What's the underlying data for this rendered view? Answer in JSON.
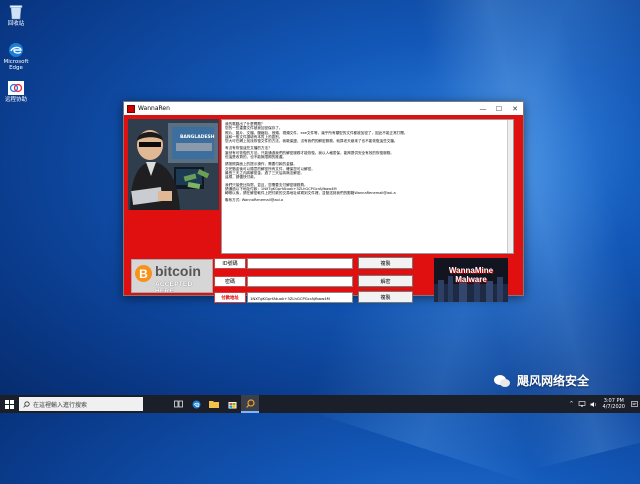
{
  "desktop": {
    "icons": [
      {
        "label": "回收站",
        "icon": "recycle-bin-icon"
      },
      {
        "label": "Microsoft Edge",
        "icon": "edge-icon"
      },
      {
        "label": "远程协助",
        "icon": "remote-assist-icon"
      }
    ]
  },
  "window": {
    "title": "WannaRen",
    "controls": {
      "minimize": "—",
      "maximize": "☐",
      "close": "✕"
    },
    "ransom_lines": [
      "我的電腦出了什麼問題？",
      "您的一些重要文件被我加密保存了。",
      "照片、圖片、文檔、壓縮包、音頻、視頻文件、exe文件等，幾乎所有類型的文件都被加密了，因此不能正常打開。",
      "這和一般文件損壞有本質上的區別。",
      "您大可在網上找找恢復文件的方法，我敢保證，沒有我們的解密服務，就算老天爺來了也不能恢復這些文檔。",
      "",
      "有沒有恢復這些文檔的方法？",
      "當然有可恢復的方法。只能通過我們的解密服務才能恢復。我以人格擔保，能夠提供安全有效的恢復服務。",
      "但這是收費的，也不能無限期的推遲。",
      "",
      "請按照頁面上的提示操作，需要付款的金額。",
      "交完贖金後可以隨意的解密所有文件，確保您可以解密。",
      "最長三天之內將解密金，過了三天后將無法解密。",
      "這樣，請儘快付款。",
      "",
      "我們只接受比特幣，並且，您需要支付解密服務費。",
      "請通過以下地址付款：1NXTgKGprfAtuok+3ZLhGCPGcrAjfbaw4M",
      "轉帳以後，請在解密軟件上把付款的交易地址填寫到文件裡，並發送到我們的郵箱WannaRenemail@aol.a",
      "",
      "聯系方式: WannaRenemail@aol.a"
    ],
    "form": {
      "row1_label": "ID號碼",
      "row1_value": "",
      "row2_label": "密碼",
      "row2_value": "",
      "row3_label": "付款地址",
      "row3_value": "1NXTgKGprfAtuok+3ZLhGCPGcrAjfbaw4M",
      "btn1": "複製",
      "btn2": "解密",
      "btn3": "複製"
    },
    "bitcoin_badge": {
      "symbol": "B",
      "word": "bitcoin",
      "accepted": "ACCEPTED HERE"
    },
    "malware_banner": "WannaMine Malware",
    "photo_caption": "BANGLADESH"
  },
  "taskbar": {
    "search_placeholder": "在這裡輸入進行搜索",
    "time": "3:07 PM",
    "date": "4/7/2020"
  },
  "watermark": {
    "text": "飓风网络安全"
  },
  "colors": {
    "window_bg": "#e11010",
    "accent": "#0078d7"
  }
}
